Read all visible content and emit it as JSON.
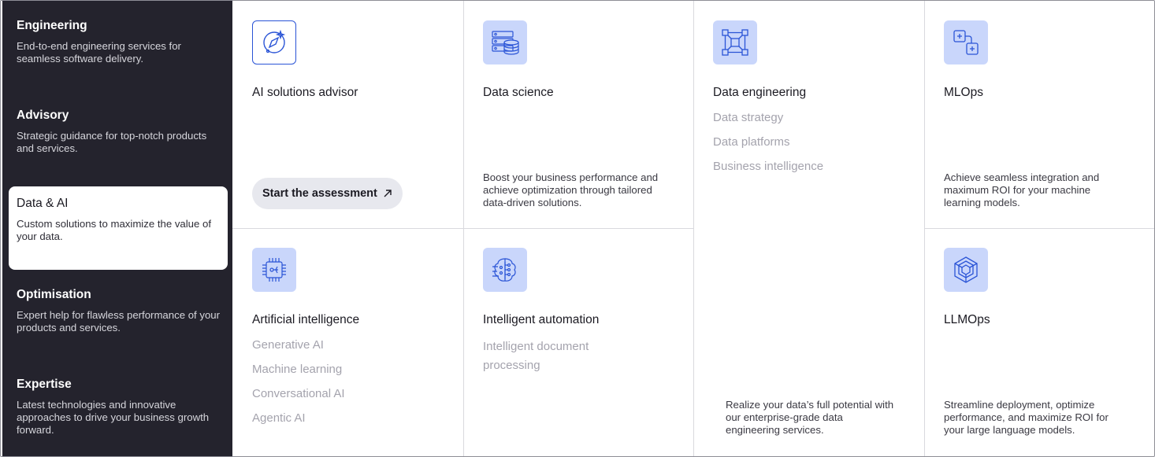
{
  "sidebar": {
    "items": [
      {
        "title": "Engineering",
        "desc": "End-to-end engineering services for seamless software delivery."
      },
      {
        "title": "Advisory",
        "desc": "Strategic guidance for top-notch products and services."
      },
      {
        "title": "Data & AI",
        "desc": "Custom solutions to maximize the value of your data."
      },
      {
        "title": "Optimisation",
        "desc": "Expert help for flawless performance of your products and services."
      },
      {
        "title": "Expertise",
        "desc": "Latest technologies and innovative approaches to drive your business growth forward."
      }
    ],
    "active_index": 2
  },
  "cards": {
    "ai_advisor": {
      "title": "AI solutions advisor",
      "button": "Start the assessment",
      "icon": "compass-sparkle-icon"
    },
    "data_science": {
      "title": "Data science",
      "desc": "Boost your business performance and achieve optimization through tailored data-driven solutions.",
      "icon": "database-server-icon"
    },
    "data_engineering": {
      "title": "Data engineering",
      "links": [
        "Data strategy",
        "Data platforms",
        "Business intelligence"
      ],
      "desc": "Realize your data’s full potential with our enterprise-grade data engineering services.",
      "icon": "nodes-grid-icon"
    },
    "mlops": {
      "title": "MLOps",
      "desc": "Achieve seamless integration and maximum ROI for your machine learning models.",
      "icon": "stacked-squares-icon"
    },
    "artificial_intelligence": {
      "title": "Artificial intelligence",
      "links": [
        "Generative AI",
        "Machine learning",
        "Conversational AI",
        "Agentic AI"
      ],
      "icon": "chip-icon"
    },
    "intelligent_automation": {
      "title": "Intelligent automation",
      "links": [
        "Intelligent document processing"
      ],
      "icon": "brain-circuit-icon"
    },
    "llmops": {
      "title": "LLMOps",
      "desc": "Streamline deployment, optimize performance, and maximize ROI for your large language models.",
      "icon": "hexagon-knot-icon"
    }
  },
  "colors": {
    "sidebar_bg": "#24232d",
    "icon_tile_bg": "#c9d6fb",
    "icon_stroke": "#2a54d6",
    "muted_link": "#a4a3ad",
    "button_bg": "#e7e8ee"
  }
}
